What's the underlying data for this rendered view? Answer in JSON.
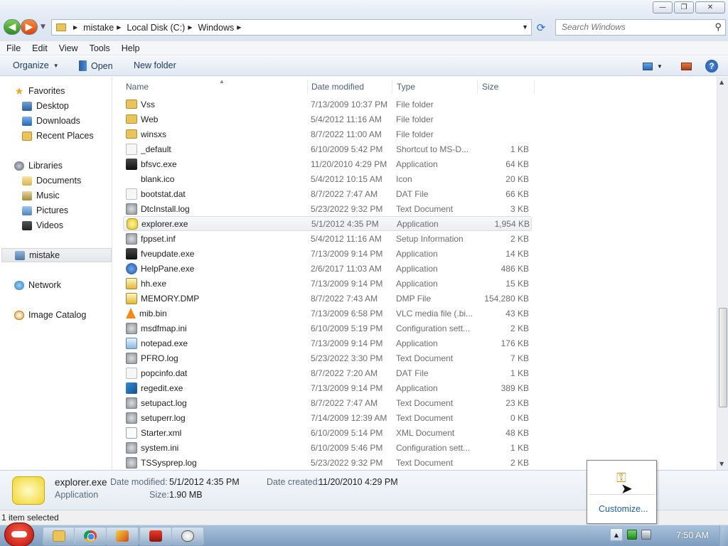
{
  "window": {
    "minimize_glyph": "—",
    "maximize_glyph": "❐",
    "close_glyph": "✕"
  },
  "address": {
    "breadcrumbs": [
      "mistake",
      "Local Disk (C:)",
      "Windows"
    ]
  },
  "search": {
    "placeholder": "Search Windows"
  },
  "menu": [
    "File",
    "Edit",
    "View",
    "Tools",
    "Help"
  ],
  "toolbar": {
    "organize": "Organize",
    "open": "Open",
    "new_folder": "New folder"
  },
  "nav": {
    "favorites": "Favorites",
    "desktop": "Desktop",
    "downloads": "Downloads",
    "recent_places": "Recent Places",
    "libraries": "Libraries",
    "documents": "Documents",
    "music": "Music",
    "pictures": "Pictures",
    "videos": "Videos",
    "homegroup": "mistake",
    "network": "Network",
    "image_catalog": "Image Catalog"
  },
  "columns": {
    "name": "Name",
    "date": "Date modified",
    "type": "Type",
    "size": "Size"
  },
  "files": [
    {
      "name": "Vss",
      "date": "7/13/2009 10:37 PM",
      "type": "File folder",
      "size": "",
      "icon": "folder"
    },
    {
      "name": "Web",
      "date": "5/4/2012 11:16 AM",
      "type": "File folder",
      "size": "",
      "icon": "folder"
    },
    {
      "name": "winsxs",
      "date": "8/7/2022 11:00 AM",
      "type": "File folder",
      "size": "",
      "icon": "folder"
    },
    {
      "name": "_default",
      "date": "6/10/2009 5:42 PM",
      "type": "Shortcut to MS-D...",
      "size": "1 KB",
      "icon": "file"
    },
    {
      "name": "bfsvc.exe",
      "date": "11/20/2010 4:29 PM",
      "type": "Application",
      "size": "64 KB",
      "icon": "app"
    },
    {
      "name": "blank.ico",
      "date": "5/4/2012 10:15 AM",
      "type": "Icon",
      "size": "20 KB",
      "icon": "none"
    },
    {
      "name": "bootstat.dat",
      "date": "8/7/2022 7:47 AM",
      "type": "DAT File",
      "size": "66 KB",
      "icon": "file"
    },
    {
      "name": "DtcInstall.log",
      "date": "5/23/2022 9:32 PM",
      "type": "Text Document",
      "size": "3 KB",
      "icon": "gear"
    },
    {
      "name": "explorer.exe",
      "date": "5/1/2012 4:35 PM",
      "type": "Application",
      "size": "1,954 KB",
      "icon": "explorer",
      "selected": true
    },
    {
      "name": "fppset.inf",
      "date": "5/4/2012 11:16 AM",
      "type": "Setup Information",
      "size": "2 KB",
      "icon": "gear"
    },
    {
      "name": "fveupdate.exe",
      "date": "7/13/2009 9:14 PM",
      "type": "Application",
      "size": "14 KB",
      "icon": "app"
    },
    {
      "name": "HelpPane.exe",
      "date": "2/6/2017 11:03 AM",
      "type": "Application",
      "size": "486 KB",
      "icon": "help"
    },
    {
      "name": "hh.exe",
      "date": "7/13/2009 9:14 PM",
      "type": "Application",
      "size": "15 KB",
      "icon": "hh"
    },
    {
      "name": "MEMORY.DMP",
      "date": "8/7/2022 7:43 AM",
      "type": "DMP File",
      "size": "154,280 KB",
      "icon": "hh"
    },
    {
      "name": "mib.bin",
      "date": "7/13/2009 6:58 PM",
      "type": "VLC media file (.bi...",
      "size": "43 KB",
      "icon": "vlc"
    },
    {
      "name": "msdfmap.ini",
      "date": "6/10/2009 5:19 PM",
      "type": "Configuration sett...",
      "size": "2 KB",
      "icon": "gear"
    },
    {
      "name": "notepad.exe",
      "date": "7/13/2009 9:14 PM",
      "type": "Application",
      "size": "176 KB",
      "icon": "note"
    },
    {
      "name": "PFRO.log",
      "date": "5/23/2022 3:30 PM",
      "type": "Text Document",
      "size": "7 KB",
      "icon": "gear"
    },
    {
      "name": "popcinfo.dat",
      "date": "8/7/2022 7:20 AM",
      "type": "DAT File",
      "size": "1 KB",
      "icon": "file"
    },
    {
      "name": "regedit.exe",
      "date": "7/13/2009 9:14 PM",
      "type": "Application",
      "size": "389 KB",
      "icon": "reg"
    },
    {
      "name": "setupact.log",
      "date": "8/7/2022 7:47 AM",
      "type": "Text Document",
      "size": "23 KB",
      "icon": "gear"
    },
    {
      "name": "setuperr.log",
      "date": "7/14/2009 12:39 AM",
      "type": "Text Document",
      "size": "0 KB",
      "icon": "gear"
    },
    {
      "name": "Starter.xml",
      "date": "6/10/2009 5:14 PM",
      "type": "XML Document",
      "size": "48 KB",
      "icon": "xml"
    },
    {
      "name": "system.ini",
      "date": "6/10/2009 5:46 PM",
      "type": "Configuration sett...",
      "size": "1 KB",
      "icon": "gear"
    },
    {
      "name": "TSSysprep.log",
      "date": "5/23/2022 9:32 PM",
      "type": "Text Document",
      "size": "2 KB",
      "icon": "gear"
    }
  ],
  "details": {
    "name": "explorer.exe",
    "kind": "Application",
    "date_modified_label": "Date modified:",
    "date_modified": "5/1/2012 4:35 PM",
    "size_label": "Size:",
    "size": "1.90 MB",
    "date_created_label": "Date created:",
    "date_created": "11/20/2010 4:29 PM"
  },
  "status": {
    "text": "1 item selected"
  },
  "popup": {
    "link": "Customize..."
  },
  "taskbar": {
    "clock": "7:50 AM"
  }
}
